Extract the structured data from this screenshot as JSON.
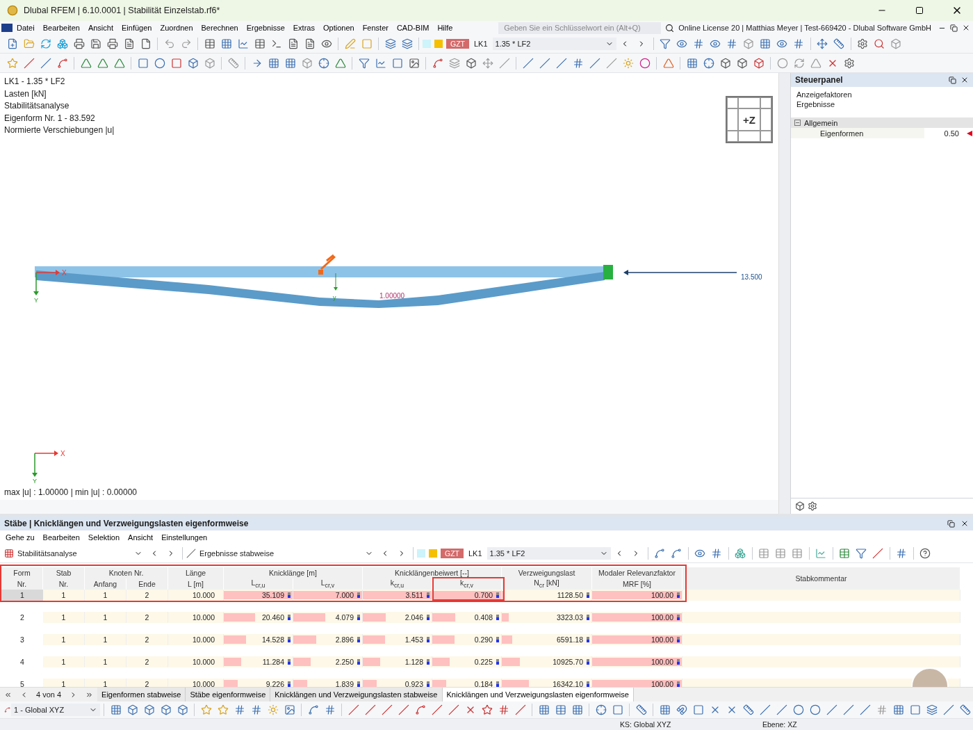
{
  "window": {
    "title": "Dlubal RFEM | 6.10.0001 | Stabilität Einzelstab.rf6*"
  },
  "menu": [
    "Datei",
    "Bearbeiten",
    "Ansicht",
    "Einfügen",
    "Zuordnen",
    "Berechnen",
    "Ergebnisse",
    "Extras",
    "Optionen",
    "Fenster",
    "CAD-BIM",
    "Hilfe"
  ],
  "search": {
    "placeholder": "Geben Sie ein Schlüsselwort ein (Alt+Q)"
  },
  "license": "Online License 20 | Matthias Meyer | Test-669420 - Dlubal Software GmbH",
  "load_selector": {
    "badge": "GZT",
    "case": "LK1",
    "combination": "1.35 * LF2"
  },
  "viewport": {
    "info_lines": [
      "LK1 - 1.35 * LF2",
      "Lasten [kN]",
      "Stabilitätsanalyse",
      "Eigenform Nr. 1 - 83.592",
      "Normierte Verschiebungen |u|"
    ],
    "view_cube": "+Z",
    "beam_axes": [
      "X",
      "Y"
    ],
    "local_axis": "y",
    "deflection_label": "1.00000",
    "load_label": "13.500",
    "global_axes": [
      "X",
      "Y"
    ],
    "summary": "max |u| : 1.00000 | min |u| : 0.00000"
  },
  "control_panel": {
    "title": "Steuerpanel",
    "links": [
      "Anzeigefaktoren",
      "Ergebnisse"
    ],
    "tree": [
      {
        "label": "Allgemein",
        "expanded": true,
        "children": [
          {
            "label": "Eigenformen",
            "value": "0.50"
          }
        ]
      }
    ]
  },
  "table_panel": {
    "title": "Stäbe | Knicklängen und Verzweigungslasten eigenformweise",
    "menu": [
      "Gehe zu",
      "Bearbeiten",
      "Selektion",
      "Ansicht",
      "Einstellungen"
    ],
    "analysis": "Stabilitätsanalyse",
    "result_mode": "Ergebnisse stabweise",
    "load_selector": {
      "badge": "GZT",
      "case": "LK1",
      "combination": "1.35 * LF2"
    },
    "columns": [
      {
        "kind": "single",
        "top": "Form",
        "bottom": "Nr."
      },
      {
        "kind": "single",
        "top": "Stab",
        "bottom": "Nr."
      },
      {
        "kind": "group",
        "label": "Knoten Nr.",
        "subs": [
          "Anfang",
          "Ende"
        ]
      },
      {
        "kind": "single",
        "top": "Länge",
        "bottom": "L [m]"
      },
      {
        "kind": "group",
        "label": "Knicklänge [m]",
        "subs": [
          "L$_{cr,u}$",
          "L$_{cr,v}$"
        ]
      },
      {
        "kind": "group",
        "label": "Knicklängenbeiwert [--]",
        "subs": [
          "k$_{cr,u}$",
          "k$_{cr,v}$"
        ]
      },
      {
        "kind": "single",
        "top": "Verzweigungslast",
        "bottom": "N$_{cr}$ [kN]"
      },
      {
        "kind": "single",
        "top": "Modaler Relevanzfaktor",
        "bottom": "MRF [%]"
      },
      {
        "kind": "comment",
        "label": "Stabkommentar"
      }
    ],
    "rows": [
      {
        "selected": true,
        "form": "1",
        "member": "1",
        "start": "1",
        "end": "2",
        "length": "10.000",
        "values": [
          {
            "text": "35.109",
            "level": 1
          },
          {
            "text": "7.000",
            "level": 1
          },
          {
            "text": "3.511",
            "level": 1
          },
          {
            "text": "0.700",
            "level": 1
          },
          {
            "text": "1128.50",
            "level": 0.03
          },
          {
            "text": "100.00",
            "level": 1
          }
        ]
      },
      {
        "selected": false,
        "form": "2",
        "member": "1",
        "start": "1",
        "end": "2",
        "length": "10.000",
        "values": [
          {
            "text": "20.460",
            "level": 0.45
          },
          {
            "text": "4.079",
            "level": 0.46
          },
          {
            "text": "2.046",
            "level": 0.33
          },
          {
            "text": "0.408",
            "level": 0.33
          },
          {
            "text": "3323.03",
            "level": 0.08
          },
          {
            "text": "100.00",
            "level": 1
          }
        ]
      },
      {
        "selected": false,
        "form": "3",
        "member": "1",
        "start": "1",
        "end": "2",
        "length": "10.000",
        "values": [
          {
            "text": "14.528",
            "level": 0.32
          },
          {
            "text": "2.896",
            "level": 0.33
          },
          {
            "text": "1.453",
            "level": 0.32
          },
          {
            "text": "0.290",
            "level": 0.32
          },
          {
            "text": "6591.18",
            "level": 0.12
          },
          {
            "text": "100.00",
            "level": 1
          }
        ]
      },
      {
        "selected": false,
        "form": "4",
        "member": "1",
        "start": "1",
        "end": "2",
        "length": "10.000",
        "values": [
          {
            "text": "11.284",
            "level": 0.25
          },
          {
            "text": "2.250",
            "level": 0.25
          },
          {
            "text": "1.128",
            "level": 0.25
          },
          {
            "text": "0.225",
            "level": 0.25
          },
          {
            "text": "10925.70",
            "level": 0.2
          },
          {
            "text": "100.00",
            "level": 1
          }
        ]
      },
      {
        "selected": false,
        "form": "5",
        "member": "1",
        "start": "1",
        "end": "2",
        "length": "10.000",
        "values": [
          {
            "text": "9.226",
            "level": 0.2
          },
          {
            "text": "1.839",
            "level": 0.2
          },
          {
            "text": "0.923",
            "level": 0.2
          },
          {
            "text": "0.184",
            "level": 0.2
          },
          {
            "text": "16342.10",
            "level": 0.3
          },
          {
            "text": "100.00",
            "level": 1
          }
        ]
      }
    ],
    "pager": "4 von 4",
    "tabs": [
      {
        "label": "Eigenformen stabweise",
        "selected": false
      },
      {
        "label": "Stäbe eigenformweise",
        "selected": false
      },
      {
        "label": "Knicklängen und Verzweigungslasten stabweise",
        "selected": false
      },
      {
        "label": "Knicklängen und Verzweigungslasten eigenformweise",
        "selected": true
      }
    ]
  },
  "bottom_toolbar": {
    "coordinate_system": "1 - Global XYZ"
  },
  "status_bar": [
    "KS: Global XYZ",
    "Ebene: XZ"
  ]
}
